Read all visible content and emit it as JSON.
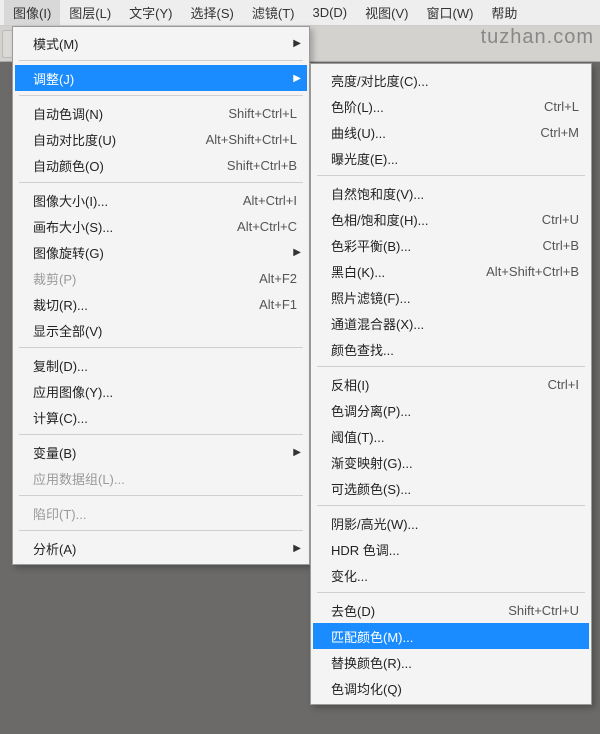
{
  "watermark": "tuzhan.com",
  "menubar": {
    "items": [
      {
        "label": "图像(I)"
      },
      {
        "label": "图层(L)"
      },
      {
        "label": "文字(Y)"
      },
      {
        "label": "选择(S)"
      },
      {
        "label": "滤镜(T)"
      },
      {
        "label": "3D(D)"
      },
      {
        "label": "视图(V)"
      },
      {
        "label": "窗口(W)"
      },
      {
        "label": "帮助"
      }
    ]
  },
  "menu1": {
    "mode": {
      "label": "模式(M)"
    },
    "adjust": {
      "label": "调整(J)"
    },
    "autotone": {
      "label": "自动色调(N)",
      "sc": "Shift+Ctrl+L"
    },
    "autocontrast": {
      "label": "自动对比度(U)",
      "sc": "Alt+Shift+Ctrl+L"
    },
    "autocolor": {
      "label": "自动颜色(O)",
      "sc": "Shift+Ctrl+B"
    },
    "imagesize": {
      "label": "图像大小(I)...",
      "sc": "Alt+Ctrl+I"
    },
    "canvassize": {
      "label": "画布大小(S)...",
      "sc": "Alt+Ctrl+C"
    },
    "imagerotate": {
      "label": "图像旋转(G)"
    },
    "crop_p": {
      "label": "裁剪(P)",
      "sc": "Alt+F2"
    },
    "crop_r": {
      "label": "裁切(R)...",
      "sc": "Alt+F1"
    },
    "revealall": {
      "label": "显示全部(V)"
    },
    "duplicate": {
      "label": "复制(D)..."
    },
    "applyimage": {
      "label": "应用图像(Y)..."
    },
    "calc": {
      "label": "计算(C)..."
    },
    "variables": {
      "label": "变量(B)"
    },
    "applydata": {
      "label": "应用数据组(L)..."
    },
    "trap": {
      "label": "陷印(T)..."
    },
    "analysis": {
      "label": "分析(A)"
    }
  },
  "menu2": {
    "brightcontrast": {
      "label": "亮度/对比度(C)..."
    },
    "levels": {
      "label": "色阶(L)...",
      "sc": "Ctrl+L"
    },
    "curves": {
      "label": "曲线(U)...",
      "sc": "Ctrl+M"
    },
    "exposure": {
      "label": "曝光度(E)..."
    },
    "vibrance": {
      "label": "自然饱和度(V)..."
    },
    "huesat": {
      "label": "色相/饱和度(H)...",
      "sc": "Ctrl+U"
    },
    "colorbal": {
      "label": "色彩平衡(B)...",
      "sc": "Ctrl+B"
    },
    "bw": {
      "label": "黑白(K)...",
      "sc": "Alt+Shift+Ctrl+B"
    },
    "photofilter": {
      "label": "照片滤镜(F)..."
    },
    "channelmix": {
      "label": "通道混合器(X)..."
    },
    "colorlookup": {
      "label": "颜色查找..."
    },
    "invert": {
      "label": "反相(I)",
      "sc": "Ctrl+I"
    },
    "posterize": {
      "label": "色调分离(P)..."
    },
    "threshold": {
      "label": "阈值(T)..."
    },
    "gradmap": {
      "label": "渐变映射(G)..."
    },
    "selcolor": {
      "label": "可选颜色(S)..."
    },
    "shadows": {
      "label": "阴影/高光(W)..."
    },
    "hdr": {
      "label": "HDR 色调..."
    },
    "variations": {
      "label": "变化..."
    },
    "desat": {
      "label": "去色(D)",
      "sc": "Shift+Ctrl+U"
    },
    "matchcolor": {
      "label": "匹配颜色(M)..."
    },
    "replacecolor": {
      "label": "替换颜色(R)..."
    },
    "equalize": {
      "label": "色调均化(Q)"
    }
  }
}
